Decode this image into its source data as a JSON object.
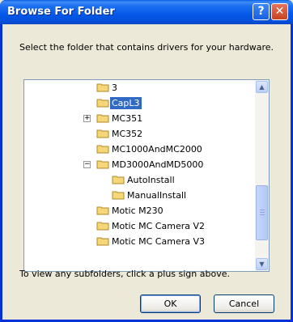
{
  "window": {
    "title": "Browse For Folder",
    "help_glyph": "?",
    "close_glyph": "✕"
  },
  "instruction": "Select the folder that contains drivers for your hardware.",
  "tree": {
    "items": [
      {
        "label": "3",
        "expander": "",
        "selected": false
      },
      {
        "label": "CapL3",
        "expander": "",
        "selected": true
      },
      {
        "label": "MC351",
        "expander": "+",
        "selected": false
      },
      {
        "label": "MC352",
        "expander": "",
        "selected": false
      },
      {
        "label": "MC1000AndMC2000",
        "expander": "",
        "selected": false
      },
      {
        "label": "MD3000AndMD5000",
        "expander": "−",
        "selected": false
      },
      {
        "label": "AutoInstall",
        "expander": "",
        "selected": false
      },
      {
        "label": "ManualInstall",
        "expander": "",
        "selected": false
      },
      {
        "label": "Motic M230",
        "expander": "",
        "selected": false
      },
      {
        "label": "Motic MC Camera V2",
        "expander": "",
        "selected": false
      },
      {
        "label": "Motic MC Camera V3",
        "expander": "",
        "selected": false
      }
    ],
    "scroll_up_glyph": "▲",
    "scroll_down_glyph": "▼"
  },
  "hint": "To view any subfolders, click a plus sign above.",
  "buttons": {
    "ok": "OK",
    "cancel": "Cancel"
  },
  "colors": {
    "selection": "#316ac5",
    "folder": "#f5d77a",
    "titlebar": "#0558e8"
  }
}
